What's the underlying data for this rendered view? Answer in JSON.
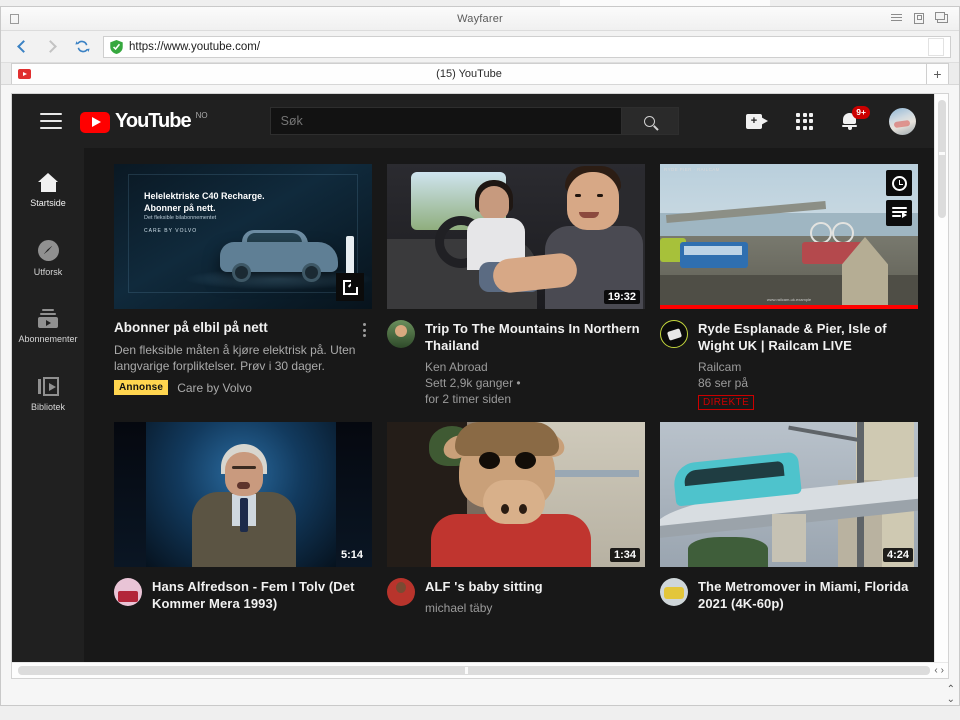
{
  "window": {
    "title": "Wayfarer",
    "controls": [
      "menu-icon",
      "page-icon",
      "restore-icon"
    ]
  },
  "browser": {
    "back_label": "",
    "forward_label": "",
    "reload_label": "",
    "url": "https://www.youtube.com/",
    "security": "secure-shield-icon",
    "tab": {
      "title": "(15) YouTube",
      "favicon": "youtube-favicon"
    },
    "new_tab_label": "+",
    "scroll": {
      "left_arrow": "‹",
      "right_arrow": "›",
      "up_arrow": "⌃",
      "down_arrow": "⌄"
    }
  },
  "youtube": {
    "header": {
      "menu_icon": "hamburger-icon",
      "logo_text": "YouTube",
      "country_code": "NO",
      "search_placeholder": "Søk",
      "search_value": "",
      "create_icon": "video-camera-plus-icon",
      "apps_icon": "apps-grid-icon",
      "notifications_icon": "bell-icon",
      "notifications_count": "9+",
      "avatar": "user-avatar"
    },
    "sidebar": [
      {
        "label": "Startside",
        "icon": "home-icon",
        "active": true
      },
      {
        "label": "Utforsk",
        "icon": "compass-icon",
        "active": false
      },
      {
        "label": "Abonnementer",
        "icon": "subscriptions-icon",
        "active": false
      },
      {
        "label": "Bibliotek",
        "icon": "library-icon",
        "active": false
      }
    ],
    "ad_card": {
      "title": "Abonner på elbil på nett",
      "description": "Den fleksible måten å kjøre elektrisk på. Uten langvarige forpliktelser. Prøv i 30 dager.",
      "badge": "Annonse",
      "brand": "Care by Volvo",
      "menu_icon": "kebab-menu-icon",
      "open_icon": "external-link-icon",
      "thumb_text": {
        "line1": "Helelektriske C40 Recharge.",
        "line2": "Abonner på nett.",
        "line3": "Det fleksible bilabonnementet",
        "line4": "CARE BY VOLVO"
      }
    },
    "videos": [
      {
        "title": "Trip To The Mountains In Northern Thailand",
        "channel": "Ken Abroad",
        "views": "Sett 2,9k ganger •",
        "age": "for 2 timer siden",
        "duration": "19:32",
        "live": false,
        "scene": "sc-thai",
        "avatar_class": "av-ken"
      },
      {
        "title": "Ryde Esplanade & Pier, Isle of Wight UK | Railcam LIVE",
        "channel": "Railcam",
        "views": "86 ser på",
        "age": "",
        "duration": "",
        "live": true,
        "live_label": "DIREKTE",
        "scene": "sc-pier",
        "avatar_class": "av-rail",
        "hover_buttons": [
          "watch-later-icon",
          "add-to-queue-icon"
        ],
        "thumb_watermark": "www.railcam-uk.example",
        "thumb_cam_label": "RYDE PIER · RAILCAM"
      },
      {
        "title": "Hans Alfredson - Fem I Tolv (Det Kommer Mera 1993)",
        "channel": "",
        "views": "",
        "age": "",
        "duration": "5:14",
        "live": false,
        "scene": "sc-hans",
        "avatar_class": "av-hans"
      },
      {
        "title": "ALF 's baby sitting",
        "channel": "michael täby",
        "views": "",
        "age": "",
        "duration": "1:34",
        "live": false,
        "scene": "sc-alf",
        "avatar_class": "av-alf"
      },
      {
        "title": "The Metromover in Miami, Florida 2021 (4K-60p)",
        "channel": "",
        "views": "",
        "age": "",
        "duration": "4:24",
        "live": false,
        "scene": "sc-metro",
        "avatar_class": "av-metro"
      }
    ]
  },
  "colors": {
    "yt_red": "#ff0000",
    "page_bg": "#181818",
    "header_bg": "#202020",
    "ad_badge": "#ffd54f",
    "live_red": "#cc0000"
  }
}
